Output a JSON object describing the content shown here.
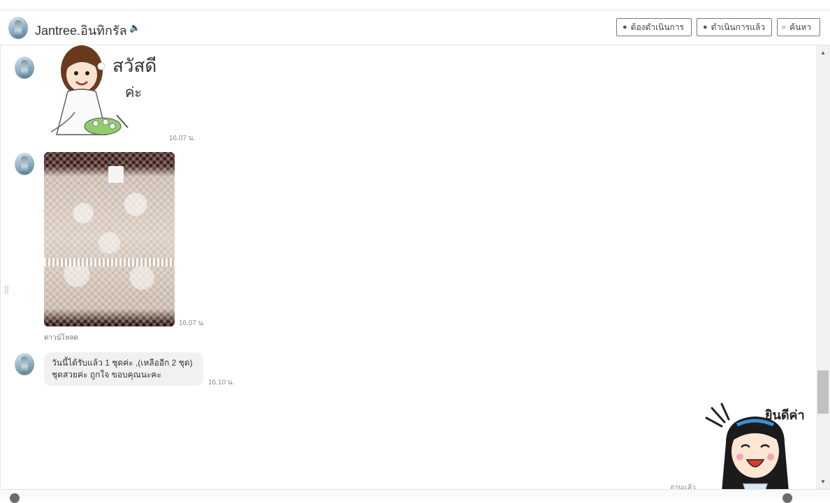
{
  "header": {
    "name": "Jantree.อินทิกรัล",
    "speaker_icon": "speaker-icon",
    "buttons": {
      "todo": "ต้องดำเนินการ",
      "done": "ดำเนินการแล้ว",
      "search": "ค้นหา"
    }
  },
  "messages": {
    "sticker_greeting": {
      "text_line1": "สวัสดี",
      "text_line2": "ค่ะ",
      "time": "16.07 น."
    },
    "photo": {
      "time": "16.07 น.",
      "download": "ดาวน์โหลด"
    },
    "text_message": {
      "line1": "วันนี้ได้รับแล้ว 1 ชุดค่ะ ,(เหลืออีก 2 ชุด)",
      "line2": "ชุดสวยค่ะ ถูกใจ ขอบคุณนะคะ",
      "time": "16.10 น."
    },
    "sticker_welcome": {
      "text": "ยินดีค่า",
      "status": "อ่านแล้ว"
    }
  },
  "icons": {
    "note": "note-icon",
    "chat": "chat-icon",
    "search": "search-icon"
  }
}
